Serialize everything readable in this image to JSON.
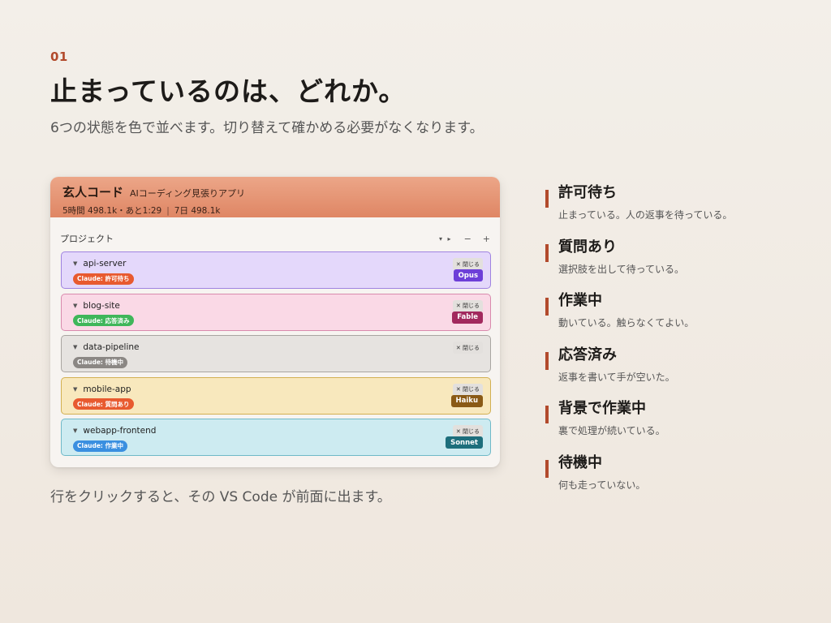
{
  "slide": {
    "number": "01",
    "headline": "止まっているのは、どれか。",
    "subhead": "6つの状態を色で並べます。切り替えて確かめる必要がなくなります。",
    "caption": "行をクリックすると、その VS Code が前面に出ます。"
  },
  "app": {
    "title": "玄人コード",
    "subtitle": "AIコーディング見張りアプリ",
    "stats": {
      "session": "5時間 498.1k・あと1:29",
      "week": "7日 498.1k"
    },
    "section_label": "プロジェクト",
    "controls": {
      "collapse": "▾ ▸",
      "minus": "−",
      "plus": "+"
    },
    "close_label": "✕ 閉じる",
    "rows": [
      {
        "name": "api-server",
        "status": "Claude: 許可待ち",
        "model": "Opus",
        "bg": "#e4d8fb",
        "border": "#9f83e0",
        "badge": "#e85a2f",
        "model_color": "#6d3fd8"
      },
      {
        "name": "blog-site",
        "status": "Claude: 応答済み",
        "model": "Fable",
        "bg": "#fad9e6",
        "border": "#d98aad",
        "badge": "#3fb65a",
        "model_color": "#a2295e"
      },
      {
        "name": "data-pipeline",
        "status": "Claude: 待機中",
        "model": "",
        "bg": "#e6e3e0",
        "border": "#a9a5a1",
        "badge": "#8b8784",
        "model_color": ""
      },
      {
        "name": "mobile-app",
        "status": "Claude: 質問あり",
        "model": "Haiku",
        "bg": "#f8e8bd",
        "border": "#d2b052",
        "badge": "#e85a2f",
        "model_color": "#8a5a16"
      },
      {
        "name": "webapp-frontend",
        "status": "Claude: 作業中",
        "model": "Sonnet",
        "bg": "#cdebf1",
        "border": "#6fb9c8",
        "badge": "#3a8fe0",
        "model_color": "#1d6e7c"
      }
    ]
  },
  "legend": [
    {
      "title": "許可待ち",
      "desc": "止まっている。人の返事を待っている。"
    },
    {
      "title": "質問あり",
      "desc": "選択肢を出して待っている。"
    },
    {
      "title": "作業中",
      "desc": "動いている。触らなくてよい。"
    },
    {
      "title": "応答済み",
      "desc": "返事を書いて手が空いた。"
    },
    {
      "title": "背景で作業中",
      "desc": "裏で処理が続いている。"
    },
    {
      "title": "待機中",
      "desc": "何も走っていない。"
    }
  ],
  "colors": {
    "accent": "#b24a2c",
    "header_top": "#eca688",
    "header_bottom": "#df8664"
  }
}
